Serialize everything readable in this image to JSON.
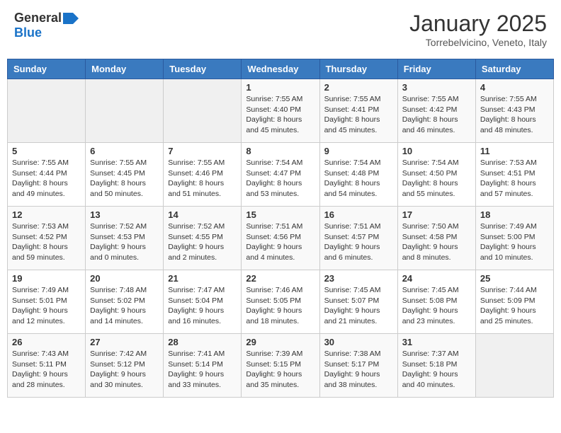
{
  "logo": {
    "general": "General",
    "blue": "Blue"
  },
  "title": "January 2025",
  "subtitle": "Torrebelvicino, Veneto, Italy",
  "weekdays": [
    "Sunday",
    "Monday",
    "Tuesday",
    "Wednesday",
    "Thursday",
    "Friday",
    "Saturday"
  ],
  "weeks": [
    [
      {
        "day": "",
        "info": ""
      },
      {
        "day": "",
        "info": ""
      },
      {
        "day": "",
        "info": ""
      },
      {
        "day": "1",
        "info": "Sunrise: 7:55 AM\nSunset: 4:40 PM\nDaylight: 8 hours\nand 45 minutes."
      },
      {
        "day": "2",
        "info": "Sunrise: 7:55 AM\nSunset: 4:41 PM\nDaylight: 8 hours\nand 45 minutes."
      },
      {
        "day": "3",
        "info": "Sunrise: 7:55 AM\nSunset: 4:42 PM\nDaylight: 8 hours\nand 46 minutes."
      },
      {
        "day": "4",
        "info": "Sunrise: 7:55 AM\nSunset: 4:43 PM\nDaylight: 8 hours\nand 48 minutes."
      }
    ],
    [
      {
        "day": "5",
        "info": "Sunrise: 7:55 AM\nSunset: 4:44 PM\nDaylight: 8 hours\nand 49 minutes."
      },
      {
        "day": "6",
        "info": "Sunrise: 7:55 AM\nSunset: 4:45 PM\nDaylight: 8 hours\nand 50 minutes."
      },
      {
        "day": "7",
        "info": "Sunrise: 7:55 AM\nSunset: 4:46 PM\nDaylight: 8 hours\nand 51 minutes."
      },
      {
        "day": "8",
        "info": "Sunrise: 7:54 AM\nSunset: 4:47 PM\nDaylight: 8 hours\nand 53 minutes."
      },
      {
        "day": "9",
        "info": "Sunrise: 7:54 AM\nSunset: 4:48 PM\nDaylight: 8 hours\nand 54 minutes."
      },
      {
        "day": "10",
        "info": "Sunrise: 7:54 AM\nSunset: 4:50 PM\nDaylight: 8 hours\nand 55 minutes."
      },
      {
        "day": "11",
        "info": "Sunrise: 7:53 AM\nSunset: 4:51 PM\nDaylight: 8 hours\nand 57 minutes."
      }
    ],
    [
      {
        "day": "12",
        "info": "Sunrise: 7:53 AM\nSunset: 4:52 PM\nDaylight: 8 hours\nand 59 minutes."
      },
      {
        "day": "13",
        "info": "Sunrise: 7:52 AM\nSunset: 4:53 PM\nDaylight: 9 hours\nand 0 minutes."
      },
      {
        "day": "14",
        "info": "Sunrise: 7:52 AM\nSunset: 4:55 PM\nDaylight: 9 hours\nand 2 minutes."
      },
      {
        "day": "15",
        "info": "Sunrise: 7:51 AM\nSunset: 4:56 PM\nDaylight: 9 hours\nand 4 minutes."
      },
      {
        "day": "16",
        "info": "Sunrise: 7:51 AM\nSunset: 4:57 PM\nDaylight: 9 hours\nand 6 minutes."
      },
      {
        "day": "17",
        "info": "Sunrise: 7:50 AM\nSunset: 4:58 PM\nDaylight: 9 hours\nand 8 minutes."
      },
      {
        "day": "18",
        "info": "Sunrise: 7:49 AM\nSunset: 5:00 PM\nDaylight: 9 hours\nand 10 minutes."
      }
    ],
    [
      {
        "day": "19",
        "info": "Sunrise: 7:49 AM\nSunset: 5:01 PM\nDaylight: 9 hours\nand 12 minutes."
      },
      {
        "day": "20",
        "info": "Sunrise: 7:48 AM\nSunset: 5:02 PM\nDaylight: 9 hours\nand 14 minutes."
      },
      {
        "day": "21",
        "info": "Sunrise: 7:47 AM\nSunset: 5:04 PM\nDaylight: 9 hours\nand 16 minutes."
      },
      {
        "day": "22",
        "info": "Sunrise: 7:46 AM\nSunset: 5:05 PM\nDaylight: 9 hours\nand 18 minutes."
      },
      {
        "day": "23",
        "info": "Sunrise: 7:45 AM\nSunset: 5:07 PM\nDaylight: 9 hours\nand 21 minutes."
      },
      {
        "day": "24",
        "info": "Sunrise: 7:45 AM\nSunset: 5:08 PM\nDaylight: 9 hours\nand 23 minutes."
      },
      {
        "day": "25",
        "info": "Sunrise: 7:44 AM\nSunset: 5:09 PM\nDaylight: 9 hours\nand 25 minutes."
      }
    ],
    [
      {
        "day": "26",
        "info": "Sunrise: 7:43 AM\nSunset: 5:11 PM\nDaylight: 9 hours\nand 28 minutes."
      },
      {
        "day": "27",
        "info": "Sunrise: 7:42 AM\nSunset: 5:12 PM\nDaylight: 9 hours\nand 30 minutes."
      },
      {
        "day": "28",
        "info": "Sunrise: 7:41 AM\nSunset: 5:14 PM\nDaylight: 9 hours\nand 33 minutes."
      },
      {
        "day": "29",
        "info": "Sunrise: 7:39 AM\nSunset: 5:15 PM\nDaylight: 9 hours\nand 35 minutes."
      },
      {
        "day": "30",
        "info": "Sunrise: 7:38 AM\nSunset: 5:17 PM\nDaylight: 9 hours\nand 38 minutes."
      },
      {
        "day": "31",
        "info": "Sunrise: 7:37 AM\nSunset: 5:18 PM\nDaylight: 9 hours\nand 40 minutes."
      },
      {
        "day": "",
        "info": ""
      }
    ]
  ]
}
